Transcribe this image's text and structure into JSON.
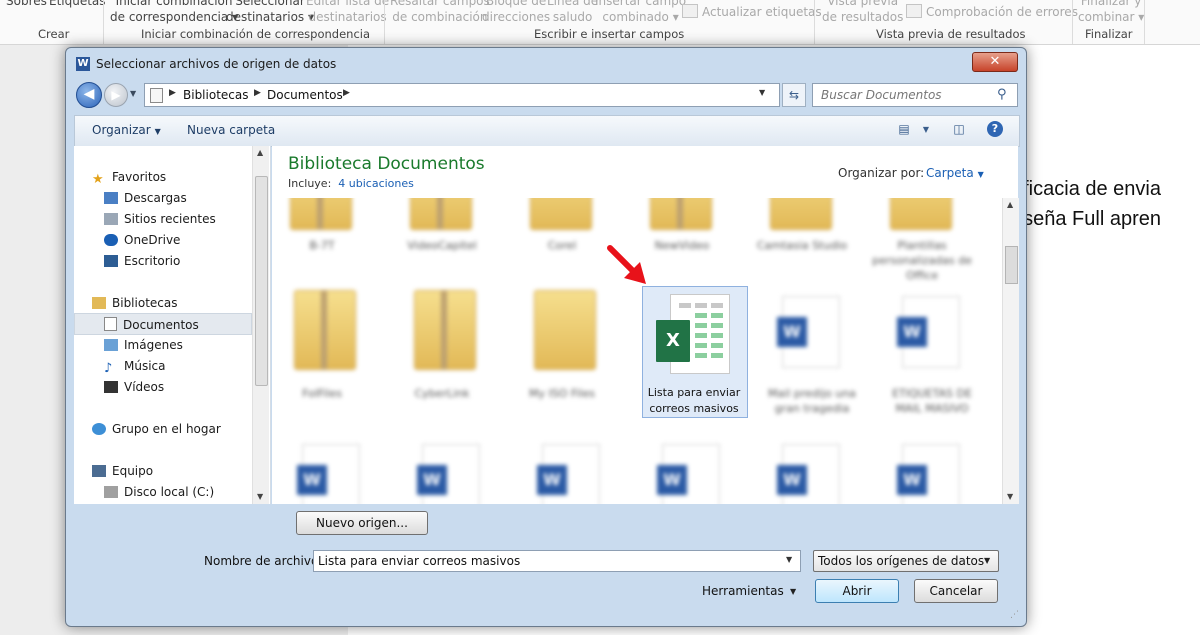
{
  "ribbon": {
    "items": {
      "sobres": "Sobres",
      "etiquetas": "Etiquetas",
      "iniciar_l1": "Iniciar combinación",
      "iniciar_l2": "de correspondencia",
      "seleccionar_l1": "Seleccionar",
      "seleccionar_l2": "destinatarios",
      "editar_l1": "Editar lista de",
      "editar_l2": "destinatarios",
      "resaltar_l1": "Resaltar campos",
      "resaltar_l2": "de combinación",
      "bloque_l1": "Bloque de",
      "bloque_l2": "direcciones",
      "linea_l1": "Línea de",
      "linea_l2": "saludo",
      "insertar_l1": "Insertar campo",
      "insertar_l2": "combinado",
      "actualizar": "Actualizar etiquetas",
      "vista_l1": "Vista previa",
      "vista_l2": "de resultados",
      "comprobacion": "Comprobación de errores",
      "finalizar_l1": "Finalizar y",
      "finalizar_l2": "combinar"
    },
    "groups": {
      "crear": "Crear",
      "iniciar": "Iniciar combinación de correspondencia",
      "escribir": "Escribir e insertar campos",
      "vista": "Vista previa de resultados",
      "finalizar": "Finalizar"
    }
  },
  "document": {
    "line1": "eficacia de envia",
    "line2": "nseña Full apren"
  },
  "dialog": {
    "title": "Seleccionar archivos de origen de datos",
    "close_label": "✕",
    "address": {
      "parts": [
        "Bibliotecas",
        "Documentos"
      ],
      "search_placeholder": "Buscar Documentos"
    },
    "toolbar": {
      "organizar": "Organizar",
      "nueva_carpeta": "Nueva carpeta"
    },
    "nav": {
      "favoritos": "Favoritos",
      "descargas": "Descargas",
      "sitios": "Sitios recientes",
      "onedrive": "OneDrive",
      "escritorio": "Escritorio",
      "bibliotecas": "Bibliotecas",
      "documentos": "Documentos",
      "imagenes": "Imágenes",
      "musica": "Música",
      "videos": "Vídeos",
      "grupo": "Grupo en el hogar",
      "equipo": "Equipo",
      "disco": "Disco local (C:)"
    },
    "content": {
      "title": "Biblioteca Documentos",
      "includes_prefix": "Incluye:",
      "includes_link": "4 ubicaciones",
      "organize_label": "Organizar por:",
      "organize_value": "Carpeta",
      "selected_file_line1": "Lista para enviar",
      "selected_file_line2": "correos masivos",
      "excel_letter": "X",
      "word_letter": "W",
      "blurred_labels": [
        "B-7T",
        "VideoCapitel",
        "Corel",
        "NewVideo",
        "Camtasia Studio",
        "Plantillas personalizadas de Office",
        "FolFiles",
        "CyberLink",
        "My ISO Files",
        "Mail predijo una gran tragedia",
        "ETIQUETAS DE MAIL MASIVO"
      ]
    },
    "bottom": {
      "nuevo_origen": "Nuevo origen...",
      "filename_label": "Nombre de archivo:",
      "filename_value": "Lista para enviar correos masivos",
      "filetype_value": "Todos los orígenes de datos",
      "herramientas": "Herramientas",
      "abrir": "Abrir",
      "cancelar": "Cancelar"
    }
  }
}
